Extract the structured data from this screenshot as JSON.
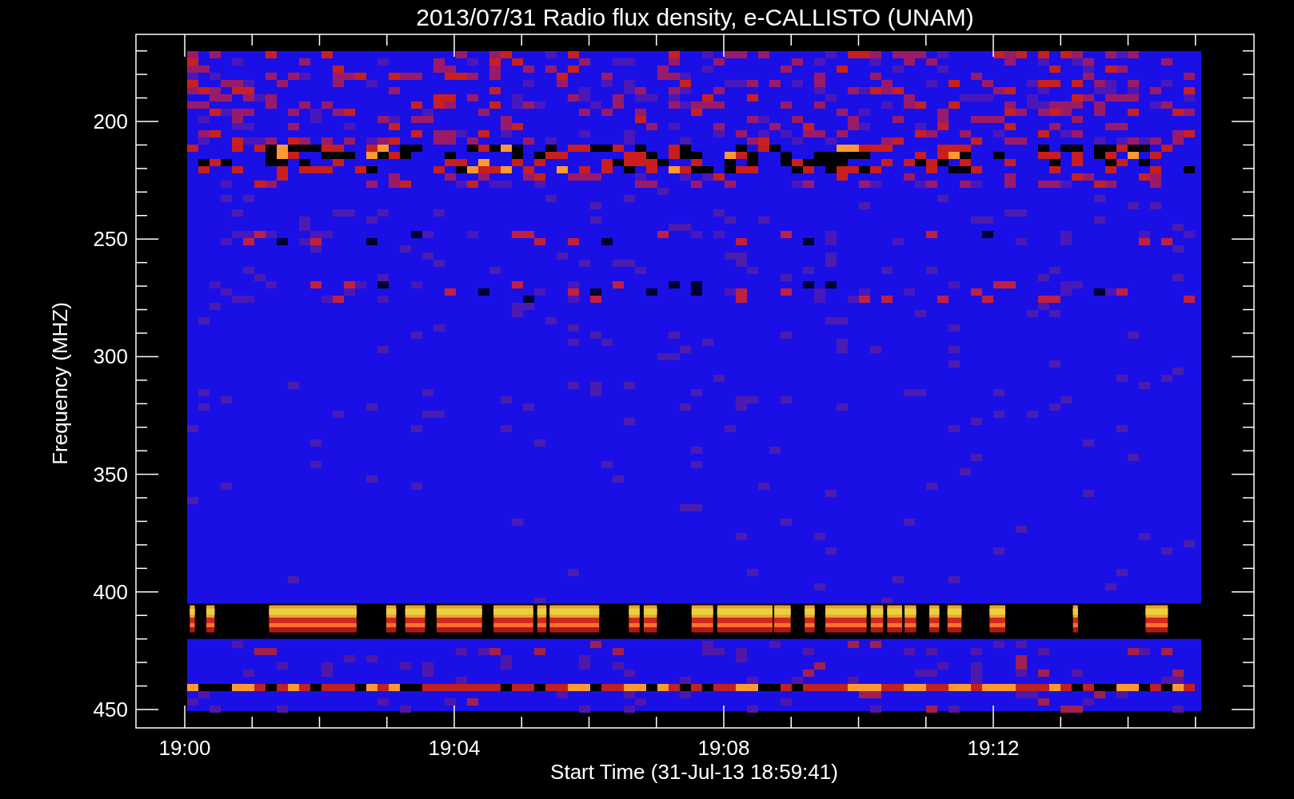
{
  "title": "2013/07/31  Radio flux density, e-CALLISTO (UNAM)",
  "y_axis": {
    "label": "Frequency (MHZ)",
    "tick_labels": [
      "200",
      "250",
      "300",
      "350",
      "400",
      "450"
    ]
  },
  "x_axis": {
    "label": "Start Time (31-Jul-13 18:59:41)",
    "tick_labels": [
      "19:00",
      "19:04",
      "19:08",
      "19:12"
    ]
  }
}
